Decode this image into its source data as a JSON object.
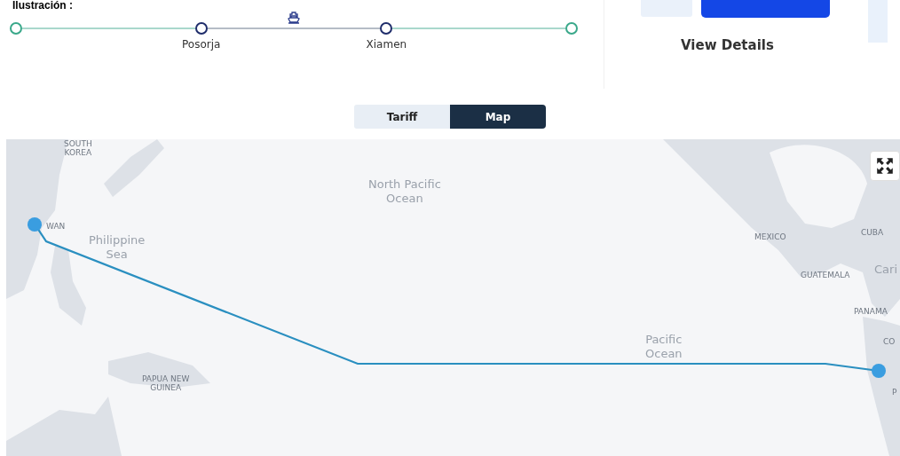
{
  "heading": "Ilustración :",
  "timeline": {
    "stops": [
      {
        "kind": "endpoint"
      },
      {
        "kind": "port",
        "label": "Posorja"
      },
      {
        "kind": "port",
        "label": "Xiamen"
      },
      {
        "kind": "endpoint"
      }
    ],
    "segments": [
      {
        "vessel": false
      },
      {
        "vessel": true
      },
      {
        "vessel": false
      }
    ]
  },
  "actions": {
    "view_details": "View Details"
  },
  "view_tabs": [
    {
      "label": "Tariff",
      "selected": false
    },
    {
      "label": "Map",
      "selected": true
    }
  ],
  "map": {
    "labels": [
      {
        "kind": "country",
        "text": "SOUTH\nKOREA"
      },
      {
        "kind": "sea",
        "text": "North Pacific\nOcean"
      },
      {
        "kind": "country",
        "text": "WAN"
      },
      {
        "kind": "sea",
        "text": "Philippine\nSea"
      },
      {
        "kind": "country",
        "text": "MEXICO"
      },
      {
        "kind": "country",
        "text": "CUBA"
      },
      {
        "kind": "country",
        "text": "GUATEMALA"
      },
      {
        "kind": "sea",
        "text": "Cari"
      },
      {
        "kind": "country",
        "text": "PANAMA"
      },
      {
        "kind": "sea",
        "text": "Pacific\nOcean"
      },
      {
        "kind": "country",
        "text": "CO"
      },
      {
        "kind": "country",
        "text": "PAPUA NEW\nGUINEA"
      },
      {
        "kind": "country",
        "text": "P"
      }
    ]
  }
}
